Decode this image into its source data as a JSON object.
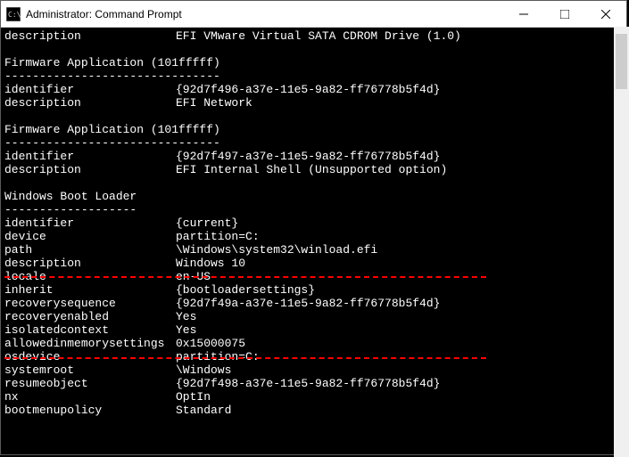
{
  "window": {
    "title": "Administrator: Command Prompt"
  },
  "output": {
    "line_desc_top_key": "description",
    "line_desc_top_val": "EFI VMware Virtual SATA CDROM Drive (1.0)",
    "sec1_title": "Firmware Application (101fffff)",
    "sec1_dashes": "-------------------------------",
    "sec1_id_key": "identifier",
    "sec1_id_val": "{92d7f496-a37e-11e5-9a82-ff76778b5f4d}",
    "sec1_desc_key": "description",
    "sec1_desc_val": "EFI Network",
    "sec2_title": "Firmware Application (101fffff)",
    "sec2_dashes": "-------------------------------",
    "sec2_id_key": "identifier",
    "sec2_id_val": "{92d7f497-a37e-11e5-9a82-ff76778b5f4d}",
    "sec2_desc_key": "description",
    "sec2_desc_val": "EFI Internal Shell (Unsupported option)",
    "sec3_title": "Windows Boot Loader",
    "sec3_dashes": "-------------------",
    "sec3_id_key": "identifier",
    "sec3_id_val": "{current}",
    "sec3_dev_key": "device",
    "sec3_dev_val": "partition=C:",
    "sec3_path_key": "path",
    "sec3_path_val": "\\Windows\\system32\\winload.efi",
    "sec3_desc_key": "description",
    "sec3_desc_val": "Windows 10",
    "sec3_loc_key": "locale",
    "sec3_loc_val": "en-US",
    "sec3_inh_key": "inherit",
    "sec3_inh_val": "{bootloadersettings}",
    "sec3_recseq_key": "recoverysequence",
    "sec3_recseq_val": "{92d7f49a-a37e-11e5-9a82-ff76778b5f4d}",
    "sec3_recen_key": "recoveryenabled",
    "sec3_recen_val": "Yes",
    "sec3_iso_key": "isolatedcontext",
    "sec3_iso_val": "Yes",
    "sec3_mem_key": "allowedinmemorysettings",
    "sec3_mem_val": "0x15000075",
    "sec3_osd_key": "osdevice",
    "sec3_osd_val": "partition=C:",
    "sec3_sys_key": "systemroot",
    "sec3_sys_val": "\\Windows",
    "sec3_res_key": "resumeobject",
    "sec3_res_val": "{92d7f498-a37e-11e5-9a82-ff76778b5f4d}",
    "sec3_nx_key": "nx",
    "sec3_nx_val": "OptIn",
    "sec3_bmp_key": "bootmenupolicy",
    "sec3_bmp_val": "Standard"
  }
}
